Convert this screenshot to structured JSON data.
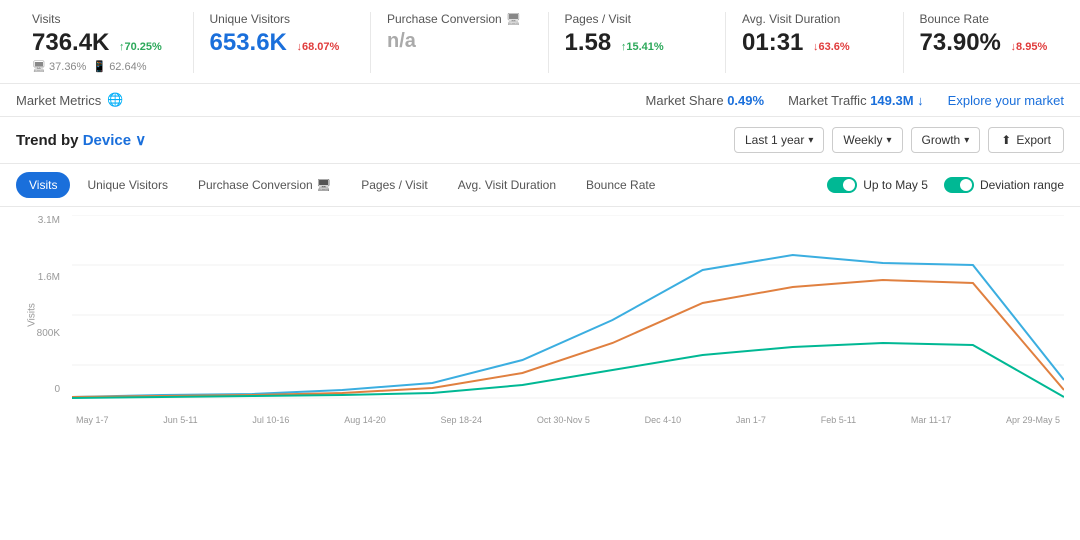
{
  "metrics": [
    {
      "id": "visits",
      "label": "Visits",
      "value": "736.4K",
      "value_color": "normal",
      "change": "+70.25%",
      "change_dir": "up",
      "sub": "🖥 37.36%  📱 62.64%"
    },
    {
      "id": "unique_visitors",
      "label": "Unique Visitors",
      "value": "653.6K",
      "value_color": "blue",
      "change": "↓68.07%",
      "change_dir": "down",
      "sub": ""
    },
    {
      "id": "purchase_conversion",
      "label": "Purchase Conversion",
      "has_monitor": true,
      "value": "n/a",
      "value_color": "normal",
      "change": "",
      "change_dir": "",
      "sub": ""
    },
    {
      "id": "pages_visit",
      "label": "Pages / Visit",
      "value": "1.58",
      "value_color": "normal",
      "change": "↑15.41%",
      "change_dir": "up",
      "sub": ""
    },
    {
      "id": "avg_visit_duration",
      "label": "Avg. Visit Duration",
      "value": "01:31",
      "value_color": "normal",
      "change": "↓63.6%",
      "change_dir": "down",
      "sub": ""
    },
    {
      "id": "bounce_rate",
      "label": "Bounce Rate",
      "value": "73.90%",
      "value_color": "normal",
      "change": "↓8.95%",
      "change_dir": "down",
      "sub": ""
    }
  ],
  "market_bar": {
    "label": "Market Metrics",
    "market_share_label": "Market Share",
    "market_share_value": "0.49%",
    "market_traffic_label": "Market Traffic",
    "market_traffic_value": "149.3M ↓",
    "explore_label": "Explore your market"
  },
  "trend": {
    "title": "Trend by",
    "device_label": "Device",
    "controls": {
      "last_year": "Last 1 year",
      "weekly": "Weekly",
      "growth": "Growth",
      "export": "Export"
    }
  },
  "tabs": [
    {
      "id": "visits",
      "label": "Visits",
      "active": true
    },
    {
      "id": "unique_visitors",
      "label": "Unique Visitors",
      "active": false
    },
    {
      "id": "purchase_conversion",
      "label": "Purchase Conversion",
      "has_monitor": true,
      "active": false
    },
    {
      "id": "pages_visit",
      "label": "Pages / Visit",
      "active": false
    },
    {
      "id": "avg_visit_duration",
      "label": "Avg. Visit Duration",
      "active": false
    },
    {
      "id": "bounce_rate",
      "label": "Bounce Rate",
      "active": false
    }
  ],
  "legend": [
    {
      "id": "up_to_may",
      "label": "Up to May 5",
      "color": "#00b894",
      "enabled": true
    },
    {
      "id": "deviation_range",
      "label": "Deviation range",
      "color": "#00b894",
      "enabled": true
    }
  ],
  "chart": {
    "y_labels": [
      "3.1M",
      "1.6M",
      "800K",
      "0"
    ],
    "y_axis_title": "Visits",
    "x_labels": [
      "May 1-7",
      "Jun 5-11",
      "Jul 10-16",
      "Aug 14-20",
      "Sep 18-24",
      "Oct 30-Nov 5",
      "Dec 4-10",
      "Jan 1-7",
      "Feb 5-11",
      "Mar 11-17",
      "Apr 29-May 5"
    ],
    "series": {
      "blue": "#3baee0",
      "orange": "#e08040",
      "green": "#00b894"
    }
  }
}
